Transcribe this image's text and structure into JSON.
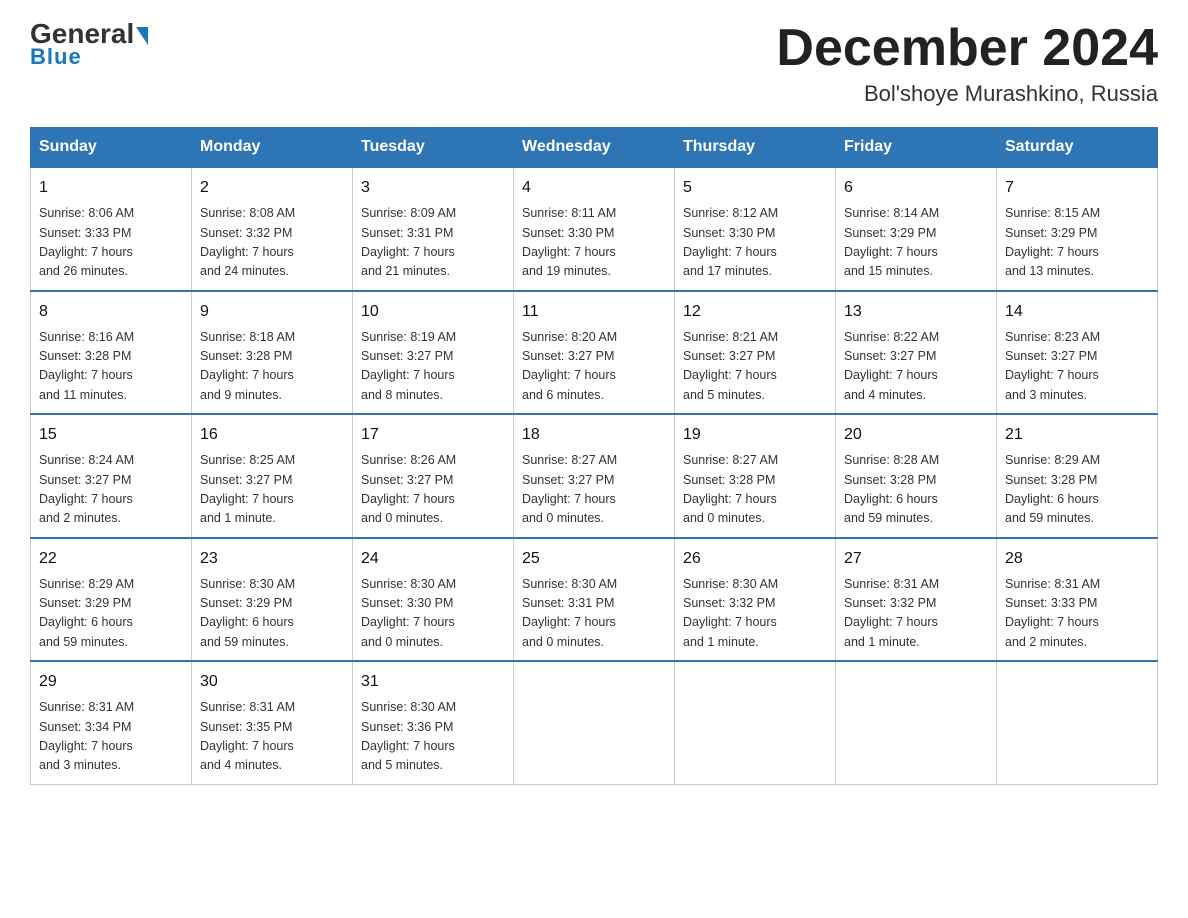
{
  "header": {
    "logo_text_black": "General",
    "logo_text_blue": "Blue",
    "month_title": "December 2024",
    "location": "Bol'shoye Murashkino, Russia"
  },
  "weekdays": [
    "Sunday",
    "Monday",
    "Tuesday",
    "Wednesday",
    "Thursday",
    "Friday",
    "Saturday"
  ],
  "weeks": [
    [
      {
        "day": "1",
        "info": "Sunrise: 8:06 AM\nSunset: 3:33 PM\nDaylight: 7 hours\nand 26 minutes."
      },
      {
        "day": "2",
        "info": "Sunrise: 8:08 AM\nSunset: 3:32 PM\nDaylight: 7 hours\nand 24 minutes."
      },
      {
        "day": "3",
        "info": "Sunrise: 8:09 AM\nSunset: 3:31 PM\nDaylight: 7 hours\nand 21 minutes."
      },
      {
        "day": "4",
        "info": "Sunrise: 8:11 AM\nSunset: 3:30 PM\nDaylight: 7 hours\nand 19 minutes."
      },
      {
        "day": "5",
        "info": "Sunrise: 8:12 AM\nSunset: 3:30 PM\nDaylight: 7 hours\nand 17 minutes."
      },
      {
        "day": "6",
        "info": "Sunrise: 8:14 AM\nSunset: 3:29 PM\nDaylight: 7 hours\nand 15 minutes."
      },
      {
        "day": "7",
        "info": "Sunrise: 8:15 AM\nSunset: 3:29 PM\nDaylight: 7 hours\nand 13 minutes."
      }
    ],
    [
      {
        "day": "8",
        "info": "Sunrise: 8:16 AM\nSunset: 3:28 PM\nDaylight: 7 hours\nand 11 minutes."
      },
      {
        "day": "9",
        "info": "Sunrise: 8:18 AM\nSunset: 3:28 PM\nDaylight: 7 hours\nand 9 minutes."
      },
      {
        "day": "10",
        "info": "Sunrise: 8:19 AM\nSunset: 3:27 PM\nDaylight: 7 hours\nand 8 minutes."
      },
      {
        "day": "11",
        "info": "Sunrise: 8:20 AM\nSunset: 3:27 PM\nDaylight: 7 hours\nand 6 minutes."
      },
      {
        "day": "12",
        "info": "Sunrise: 8:21 AM\nSunset: 3:27 PM\nDaylight: 7 hours\nand 5 minutes."
      },
      {
        "day": "13",
        "info": "Sunrise: 8:22 AM\nSunset: 3:27 PM\nDaylight: 7 hours\nand 4 minutes."
      },
      {
        "day": "14",
        "info": "Sunrise: 8:23 AM\nSunset: 3:27 PM\nDaylight: 7 hours\nand 3 minutes."
      }
    ],
    [
      {
        "day": "15",
        "info": "Sunrise: 8:24 AM\nSunset: 3:27 PM\nDaylight: 7 hours\nand 2 minutes."
      },
      {
        "day": "16",
        "info": "Sunrise: 8:25 AM\nSunset: 3:27 PM\nDaylight: 7 hours\nand 1 minute."
      },
      {
        "day": "17",
        "info": "Sunrise: 8:26 AM\nSunset: 3:27 PM\nDaylight: 7 hours\nand 0 minutes."
      },
      {
        "day": "18",
        "info": "Sunrise: 8:27 AM\nSunset: 3:27 PM\nDaylight: 7 hours\nand 0 minutes."
      },
      {
        "day": "19",
        "info": "Sunrise: 8:27 AM\nSunset: 3:28 PM\nDaylight: 7 hours\nand 0 minutes."
      },
      {
        "day": "20",
        "info": "Sunrise: 8:28 AM\nSunset: 3:28 PM\nDaylight: 6 hours\nand 59 minutes."
      },
      {
        "day": "21",
        "info": "Sunrise: 8:29 AM\nSunset: 3:28 PM\nDaylight: 6 hours\nand 59 minutes."
      }
    ],
    [
      {
        "day": "22",
        "info": "Sunrise: 8:29 AM\nSunset: 3:29 PM\nDaylight: 6 hours\nand 59 minutes."
      },
      {
        "day": "23",
        "info": "Sunrise: 8:30 AM\nSunset: 3:29 PM\nDaylight: 6 hours\nand 59 minutes."
      },
      {
        "day": "24",
        "info": "Sunrise: 8:30 AM\nSunset: 3:30 PM\nDaylight: 7 hours\nand 0 minutes."
      },
      {
        "day": "25",
        "info": "Sunrise: 8:30 AM\nSunset: 3:31 PM\nDaylight: 7 hours\nand 0 minutes."
      },
      {
        "day": "26",
        "info": "Sunrise: 8:30 AM\nSunset: 3:32 PM\nDaylight: 7 hours\nand 1 minute."
      },
      {
        "day": "27",
        "info": "Sunrise: 8:31 AM\nSunset: 3:32 PM\nDaylight: 7 hours\nand 1 minute."
      },
      {
        "day": "28",
        "info": "Sunrise: 8:31 AM\nSunset: 3:33 PM\nDaylight: 7 hours\nand 2 minutes."
      }
    ],
    [
      {
        "day": "29",
        "info": "Sunrise: 8:31 AM\nSunset: 3:34 PM\nDaylight: 7 hours\nand 3 minutes."
      },
      {
        "day": "30",
        "info": "Sunrise: 8:31 AM\nSunset: 3:35 PM\nDaylight: 7 hours\nand 4 minutes."
      },
      {
        "day": "31",
        "info": "Sunrise: 8:30 AM\nSunset: 3:36 PM\nDaylight: 7 hours\nand 5 minutes."
      },
      {
        "day": "",
        "info": ""
      },
      {
        "day": "",
        "info": ""
      },
      {
        "day": "",
        "info": ""
      },
      {
        "day": "",
        "info": ""
      }
    ]
  ]
}
